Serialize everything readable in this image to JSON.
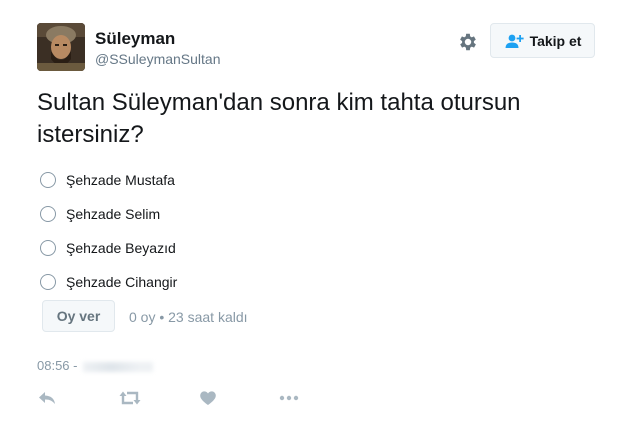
{
  "tweet": {
    "author": {
      "name": "Süleyman",
      "handle": "@SSuleymanSultan",
      "avatar_icon": "profile-photo"
    },
    "follow_button": {
      "label": "Takip et",
      "icon": "add-user-icon"
    },
    "settings_icon": "gear-icon",
    "question": "Sultan Süleyman'dan sonra kim tahta otursun istersiniz?",
    "poll": {
      "options": [
        {
          "label": "Şehzade Mustafa"
        },
        {
          "label": "Şehzade Selim"
        },
        {
          "label": "Şehzade Beyazıd"
        },
        {
          "label": "Şehzade Cihangir"
        }
      ],
      "vote_button_label": "Oy ver",
      "meta": "0 oy • 23 saat kaldı"
    },
    "timestamp": "08:56 -",
    "actions": [
      "reply-icon",
      "retweet-icon",
      "like-icon",
      "more-icon"
    ]
  },
  "colors": {
    "text": "#14171a",
    "secondary": "#8899a6",
    "border": "#e1e8ed",
    "button_bg": "#f5f8fa"
  }
}
